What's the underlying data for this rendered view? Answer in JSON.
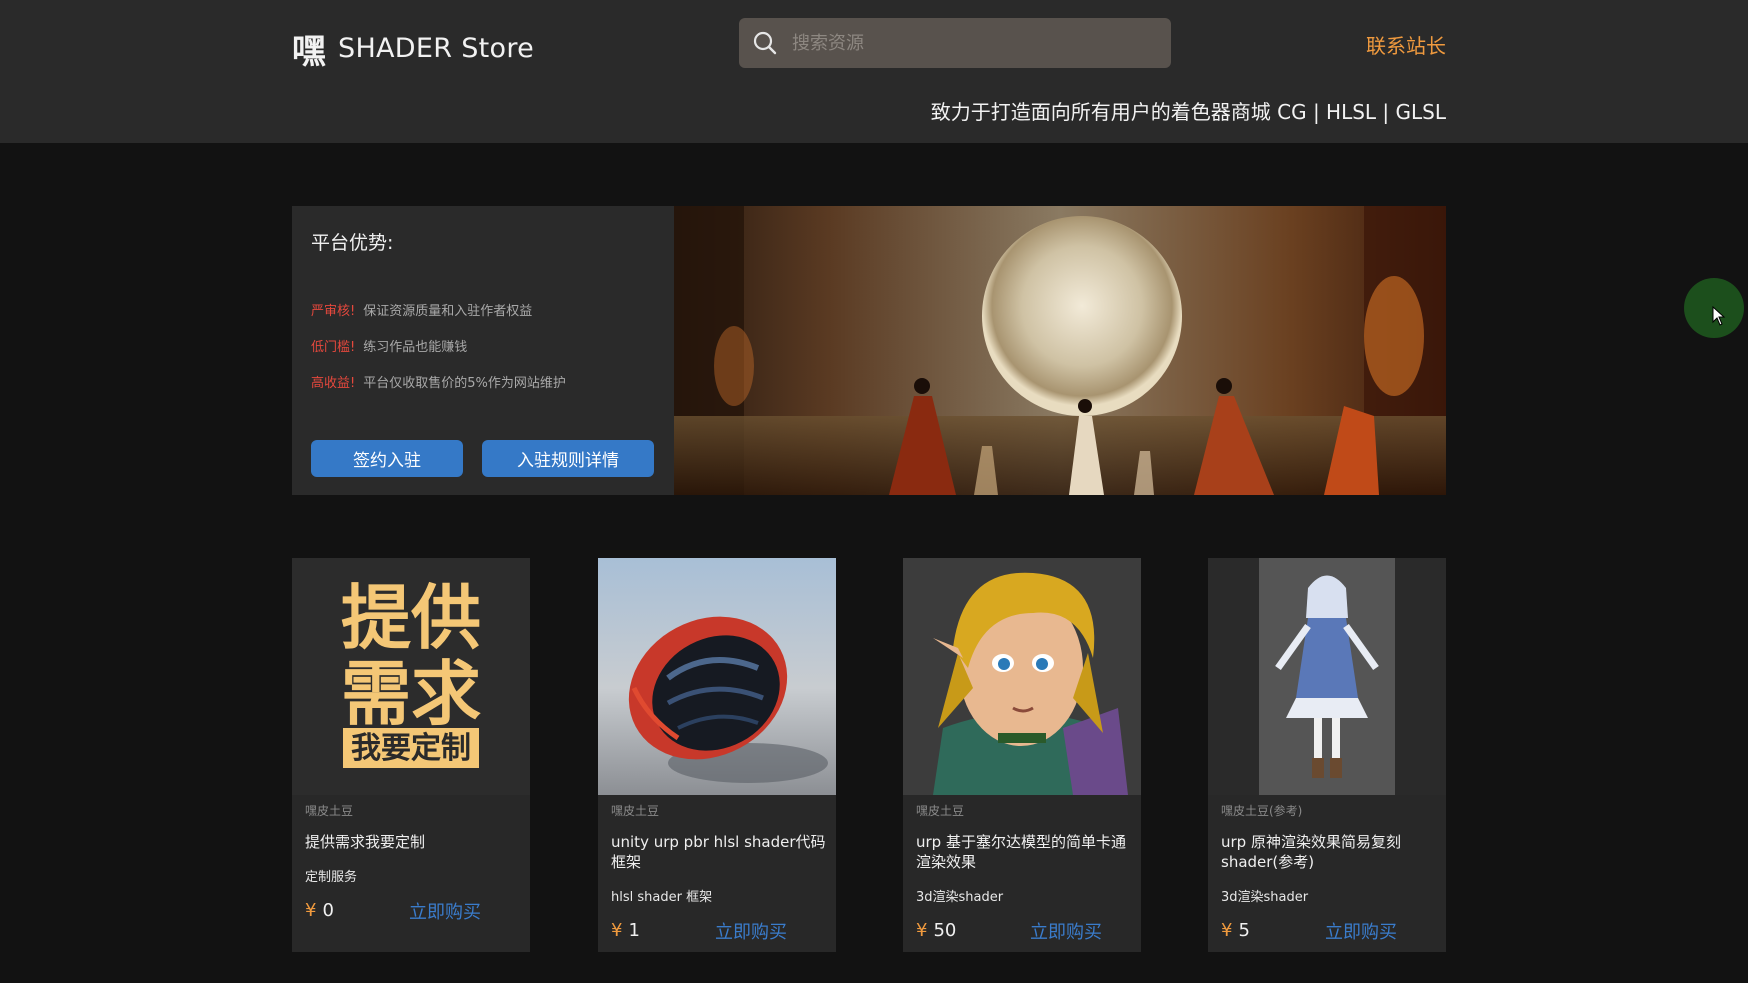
{
  "header": {
    "logo_mark": "嘿",
    "logo_text": "SHADER Store",
    "search_placeholder": "搜索资源",
    "contact_label": "联系站长",
    "tagline": "致力于打造面向所有用户的着色器商城 CG | HLSL | GLSL"
  },
  "hero": {
    "title": "平台优势:",
    "advantages": [
      {
        "key": "严审核!",
        "value": "保证资源质量和入驻作者权益"
      },
      {
        "key": "低门槛!",
        "value": "练习作品也能赚钱"
      },
      {
        "key": "高收益!",
        "value": "平台仅收取售价的5%作为网站维护"
      }
    ],
    "buttons": {
      "join": "签约入驻",
      "rules": "入驻规则详情"
    }
  },
  "cards": [
    {
      "poster_lines": [
        "提供",
        "需求",
        "我要定制"
      ],
      "author": "嘿皮土豆",
      "title": "提供需求我要定制",
      "tag": "定制服务",
      "currency": "¥",
      "price": "0",
      "buy": "立即购买"
    },
    {
      "author": "嘿皮土豆",
      "title": "unity urp pbr hlsl shader代码框架",
      "tag": "hlsl shader 框架",
      "currency": "¥",
      "price": "1",
      "buy": "立即购买"
    },
    {
      "author": "嘿皮土豆",
      "title": "urp 基于塞尔达模型的简单卡通渲染效果",
      "tag": "3d渲染shader",
      "currency": "¥",
      "price": "50",
      "buy": "立即购买"
    },
    {
      "author": "嘿皮土豆(参考)",
      "title": "urp 原神渲染效果简易复刻shader(参考)",
      "tag": "3d渲染shader",
      "currency": "¥",
      "price": "5",
      "buy": "立即购买"
    }
  ],
  "colors": {
    "accent_orange": "#f09a3e",
    "link_blue": "#3a7ccc",
    "button_blue": "#3579c7",
    "warning_red": "#e5483d"
  }
}
